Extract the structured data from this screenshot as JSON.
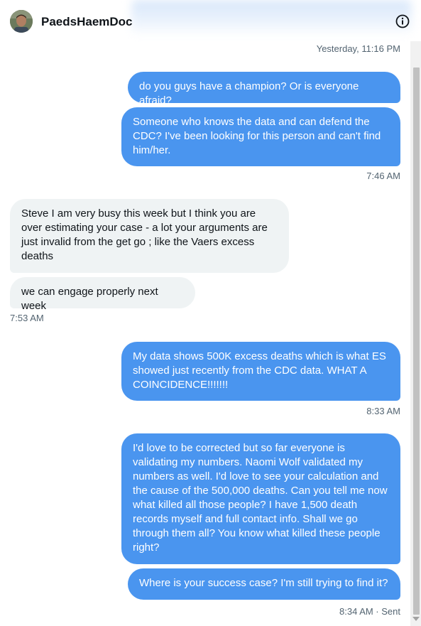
{
  "header": {
    "name": "PaedsHaemDoc"
  },
  "messages": [
    {
      "from": "me",
      "text": "do you guys have a champion? Or is everyone afraid?"
    },
    {
      "from": "me",
      "text": "Someone who knows the data and can defend the CDC? I've been looking for this person and can't find him/her."
    },
    {
      "from": "them",
      "text": "Steve  I am very busy this week  but I think you are over estimating your case - a lot your arguments are just invalid from the get go ; like the Vaers excess deaths"
    },
    {
      "from": "them",
      "text": "we can engage properly next week"
    },
    {
      "from": "me",
      "text": "My data shows 500K excess deaths which is what ES showed just recently from the CDC data. WHAT A COINCIDENCE!!!!!!!"
    },
    {
      "from": "me",
      "text": "I'd love to be corrected but so far everyone is validating my numbers. Naomi Wolf validated my numbers as well. I'd love to see your calculation and the cause of the 500,000 deaths. Can you tell me now what killed all those people? I have 1,500 death records myself and full contact info. Shall we go through them all? You know what killed these people right?"
    },
    {
      "from": "me",
      "text": "Where is your success case? I'm still trying to find it?"
    }
  ],
  "timestamps": {
    "t0": "Yesterday, 11:16 PM",
    "t1": "7:46 AM",
    "t2": "7:53 AM",
    "t3": "8:33 AM",
    "t4": "8:34 AM · Sent"
  },
  "colors": {
    "outgoing_bubble": "#4a95ef",
    "incoming_bubble": "#eff3f4",
    "timestamp_text": "#536471"
  },
  "icons": {
    "info": "info-icon",
    "avatar": "avatar"
  }
}
